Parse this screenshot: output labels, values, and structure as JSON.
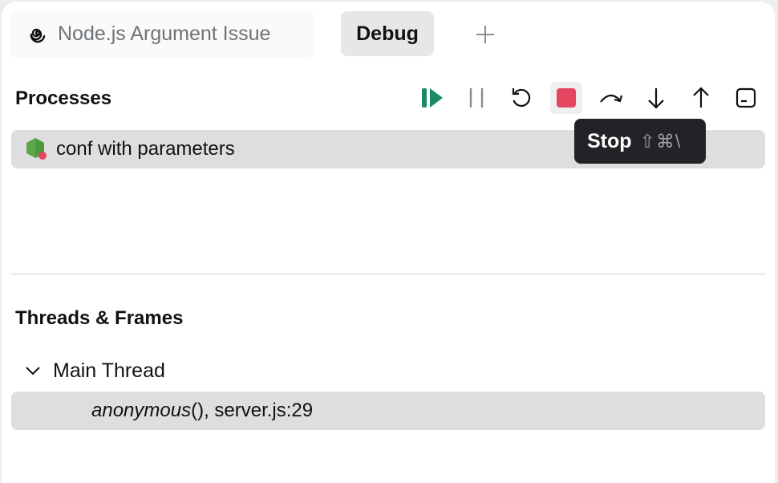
{
  "tabs": {
    "project": {
      "label": "Node.js Argument Issue",
      "icon": "swirl-icon"
    },
    "debug": {
      "label": "Debug"
    },
    "add": {
      "icon": "plus-icon"
    }
  },
  "processes": {
    "title": "Processes",
    "toolbar": [
      {
        "name": "resume",
        "icon": "resume-icon",
        "color": "#1a8a66"
      },
      {
        "name": "pause",
        "icon": "pause-icon",
        "color": "#8a8d90"
      },
      {
        "name": "restart",
        "icon": "restart-icon",
        "color": "#111111"
      },
      {
        "name": "stop",
        "icon": "stop-icon",
        "color": "#e4465f",
        "active": true
      },
      {
        "name": "step-over",
        "icon": "step-over-icon",
        "color": "#111111"
      },
      {
        "name": "step-into",
        "icon": "step-into-icon",
        "color": "#111111"
      },
      {
        "name": "step-out",
        "icon": "step-out-icon",
        "color": "#111111"
      },
      {
        "name": "console",
        "icon": "console-icon",
        "color": "#111111"
      }
    ],
    "items": [
      {
        "label": "conf with parameters",
        "icon": "nodejs-icon",
        "status_color": "#e4465f"
      }
    ]
  },
  "tooltip": {
    "label": "Stop",
    "shortcut": "⇧⌘\\"
  },
  "threads": {
    "title": "Threads & Frames",
    "main_thread": {
      "label": "Main Thread",
      "expanded": true
    },
    "frames": [
      {
        "function": "anonymous",
        "suffix": "(), server.js:29"
      }
    ]
  }
}
